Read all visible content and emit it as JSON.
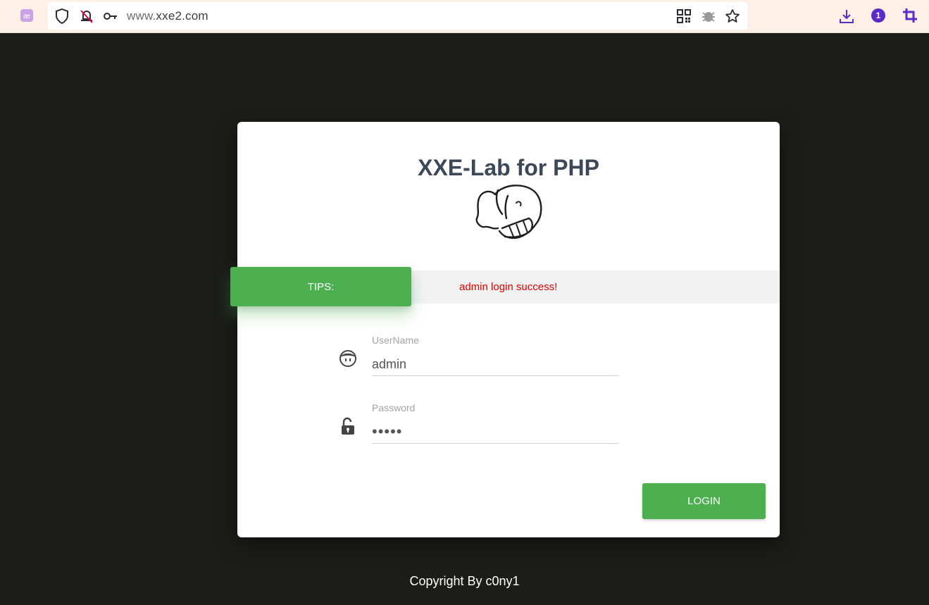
{
  "browser": {
    "url_host": "www.",
    "url_domain": "xxe2.com",
    "profile_badge": "1"
  },
  "card": {
    "title": "XXE-Lab for PHP",
    "tips_label": "TIPS:",
    "tips_message": "admin login success!",
    "username": {
      "label": "UserName",
      "value": "admin"
    },
    "password": {
      "label": "Password",
      "value": "•••••"
    },
    "login_button": "LOGIN"
  },
  "footer": {
    "copyright": "Copyright By c0ny1"
  },
  "colors": {
    "accent": "#4caf50",
    "error": "#e00000",
    "page_background": "#1c1d19",
    "title": "#3c4858"
  }
}
